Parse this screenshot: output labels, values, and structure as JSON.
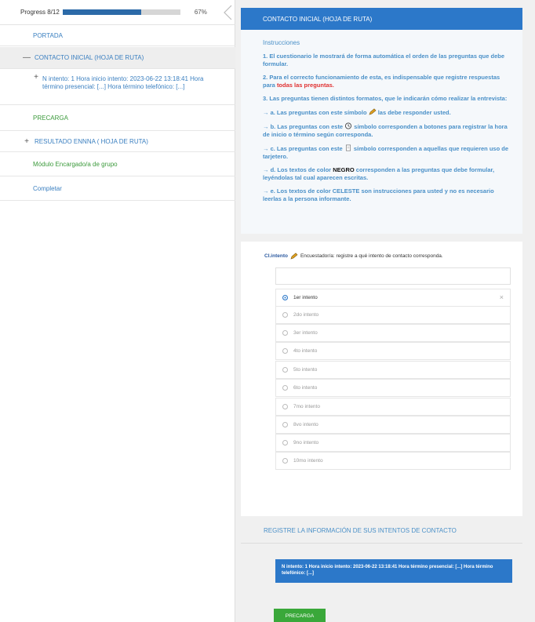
{
  "progress": {
    "label": "Progress 8/12",
    "fraction": 0.67,
    "percent_text": "67%",
    "fill_color": "#2c6aa8"
  },
  "sidebar": {
    "portada": "PORTADA",
    "contacto": "CONTACTO INICIAL (HOJA DE RUTA)",
    "contacto_symbol": "—",
    "intento_symbol": "+",
    "intento": "N intento: 1 Hora inicio intento: 2023-06-22 13:18:41 Hora término presencial: [...] Hora término telefónico: [...]",
    "precarga": "PRECARGA",
    "resultado": "RESULTADO ENNNA ( HOJA DE RUTA)",
    "resultado_symbol": "+",
    "modulo": "Módulo Encargado/a de grupo",
    "completar": "Completar"
  },
  "header": {
    "title": "CONTACTO INICIAL (HOJA DE RUTA)",
    "color": "#2c78c9"
  },
  "instructions": {
    "title": "Instrucciones",
    "p1": "1. El cuestionario le mostrará de forma automática el orden de las preguntas que debe formular.",
    "p2_a": "2. Para el correcto funcionamiento de esta, es indispensable que registre respuestas para ",
    "p2_red": "todas las preguntas.",
    "p3": "3. Las preguntas tienen distintos formatos, que le indicarán cómo realizar la entrevista:",
    "pa_a": "→ a. Las preguntas con este símbolo ",
    "pa_b": " las debe responder usted.",
    "pb_a": "→ b. Las preguntas con este ",
    "pb_b": " símbolo corresponden a botones para registrar la hora de inicio o término según corresponda.",
    "pc_a": "→ c. Las preguntas con este ",
    "pc_b": " símbolo corresponden a aquellas que requieren uso de tarjetero.",
    "pd_a": "→ d. Los textos de color ",
    "pd_black": "NEGRO",
    "pd_b": " corresponden a las preguntas que debe formular, leyéndolas tal cual aparecen escritas.",
    "pe": "→ e. Los textos de color CELESTE son instrucciones para usted y no es necesario leerlas a la persona informante.",
    "pencil_icon": "pencil-icon",
    "clock_icon": "clock-icon",
    "card_icon": "card-icon"
  },
  "question": {
    "code": "CI.intento",
    "text": "Encuestador/a: registre a qué intento de contacto corresponda.",
    "options": [
      "1er intento",
      "2do intento",
      "3er intento",
      "4to intento",
      "5to intento",
      "6to intento",
      "7mo intento",
      "8vo intento",
      "9no intento",
      "10mo intento"
    ],
    "selected_index": 0
  },
  "register": {
    "title": "REGISTRE LA INFORMACIÓN DE SUS INTENTOS DE CONTACTO",
    "panel_text": "N intento: 1 Hora inicio intento: 2023-06-22 13:18:41 Hora término presencial: [...] Hora término telefónico: [...]"
  },
  "buttons": {
    "precarga": "PRECARGA",
    "precarga_color": "#3aa83a"
  }
}
